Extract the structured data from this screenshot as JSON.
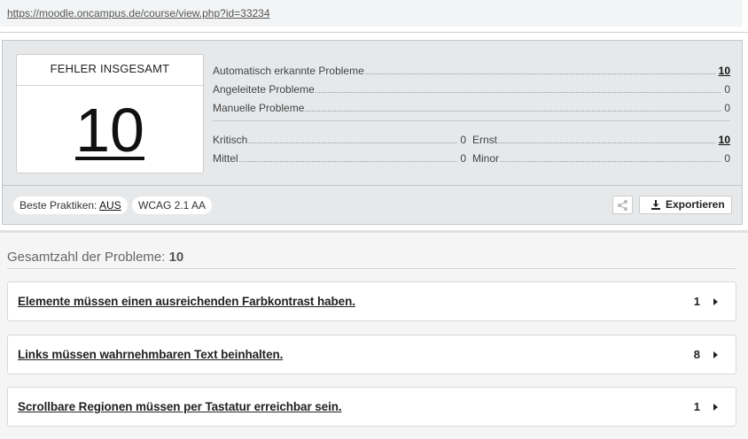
{
  "url": "https://moodle.oncampus.de/course/view.php?id=33234",
  "summary": {
    "total_label": "FEHLER INSGESAMT",
    "total_value": "10",
    "auto": {
      "label": "Automatisch erkannte Probleme",
      "value": "10"
    },
    "guided": {
      "label": "Angeleitete Probleme",
      "value": "0"
    },
    "manual": {
      "label": "Manuelle Probleme",
      "value": "0"
    },
    "critical": {
      "label": "Kritisch",
      "value": "0"
    },
    "serious": {
      "label": "Ernst",
      "value": "10"
    },
    "moderate": {
      "label": "Mittel",
      "value": "0"
    },
    "minor": {
      "label": "Minor",
      "value": "0"
    }
  },
  "footer": {
    "best_practices_label": "Beste Praktiken:",
    "best_practices_value": "AUS",
    "standard": "WCAG 2.1 AA",
    "export_label": "Exportieren"
  },
  "issues": {
    "heading_label": "Gesamtzahl der Probleme:",
    "heading_count": "10",
    "items": [
      {
        "title": "Elemente müssen einen ausreichenden Farbkontrast haben.",
        "count": "1"
      },
      {
        "title": "Links müssen wahrnehmbaren Text beinhalten.",
        "count": "8"
      },
      {
        "title": "Scrollbare Regionen müssen per Tastatur erreichbar sein.",
        "count": "1"
      }
    ]
  },
  "colors": {
    "panel_bg": "#e6e8ea",
    "lower_bg": "#f5f5f5"
  },
  "icons": {
    "share": "share-icon",
    "export": "download-icon",
    "expand": "caret-right-icon"
  }
}
